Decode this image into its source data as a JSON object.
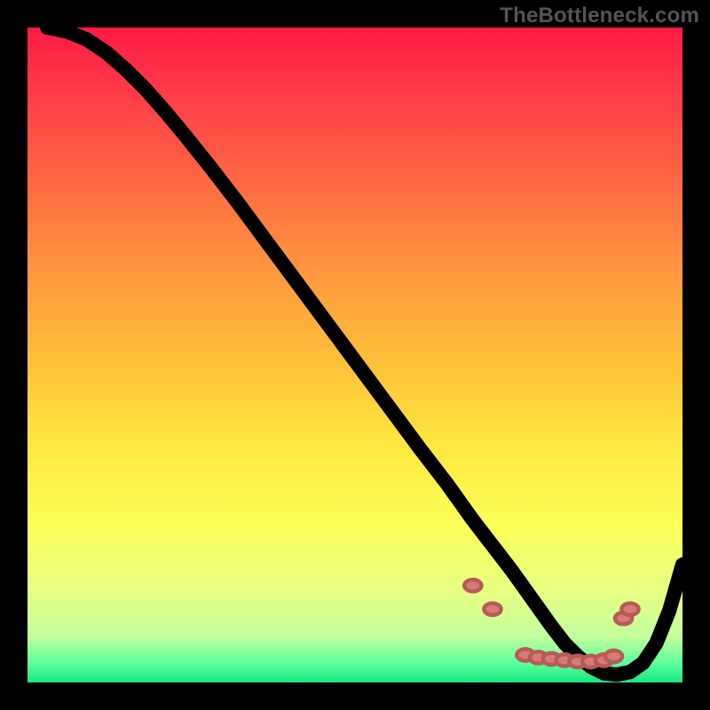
{
  "watermark": "TheBottleneck.com",
  "chart_data": {
    "type": "line",
    "title": "",
    "xlabel": "",
    "ylabel": "",
    "xlim": [
      0,
      100
    ],
    "ylim": [
      0,
      100
    ],
    "grid": false,
    "legend_position": "none",
    "series": [
      {
        "name": "bottleneck-curve",
        "x": [
          3,
          6,
          9,
          12,
          15,
          18,
          21,
          24,
          28,
          32,
          36,
          40,
          44,
          48,
          52,
          56,
          60,
          64,
          68,
          70,
          72,
          74,
          76,
          78,
          80,
          82,
          84,
          86,
          88,
          90,
          92,
          94,
          96,
          98,
          100
        ],
        "y": [
          100,
          99.4,
          98.2,
          96.2,
          93.6,
          90.6,
          87.2,
          83.6,
          78.6,
          73.4,
          68.0,
          62.6,
          57.2,
          51.8,
          46.4,
          41.0,
          35.6,
          30.4,
          24.8,
          22.2,
          19.6,
          17.0,
          14.2,
          11.4,
          8.6,
          6.0,
          4.0,
          2.4,
          1.4,
          1.2,
          1.6,
          3.0,
          6.0,
          11.0,
          18.0
        ]
      }
    ],
    "markers": {
      "name": "highlight-points",
      "shape": "oval",
      "color": "#d87a78",
      "points": [
        {
          "x": 68,
          "y": 14.8
        },
        {
          "x": 71,
          "y": 11.2
        },
        {
          "x": 76,
          "y": 4.2
        },
        {
          "x": 78,
          "y": 3.8
        },
        {
          "x": 80,
          "y": 3.6
        },
        {
          "x": 82,
          "y": 3.4
        },
        {
          "x": 84,
          "y": 3.2
        },
        {
          "x": 86,
          "y": 3.2
        },
        {
          "x": 88,
          "y": 3.4
        },
        {
          "x": 89.5,
          "y": 4.0
        },
        {
          "x": 91,
          "y": 9.8
        },
        {
          "x": 92,
          "y": 11.2
        }
      ]
    },
    "background_gradient": {
      "orientation": "vertical",
      "stops": [
        {
          "pos": 0.0,
          "color": "#ff1a44"
        },
        {
          "pos": 0.1,
          "color": "#ff3b48"
        },
        {
          "pos": 0.24,
          "color": "#ff6a43"
        },
        {
          "pos": 0.38,
          "color": "#ff9a3e"
        },
        {
          "pos": 0.52,
          "color": "#ffc339"
        },
        {
          "pos": 0.64,
          "color": "#ffe940"
        },
        {
          "pos": 0.76,
          "color": "#fbff58"
        },
        {
          "pos": 0.86,
          "color": "#e8ff82"
        },
        {
          "pos": 0.93,
          "color": "#c3ff9d"
        },
        {
          "pos": 0.97,
          "color": "#5fff9c"
        },
        {
          "pos": 1.0,
          "color": "#13e97e"
        }
      ]
    }
  }
}
